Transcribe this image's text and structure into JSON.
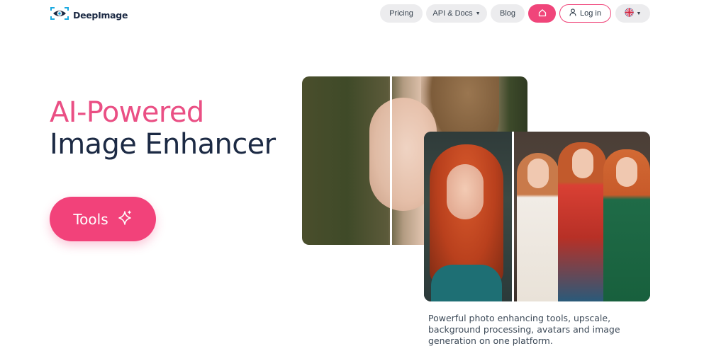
{
  "brand": {
    "name": "DeepImage"
  },
  "nav": {
    "pricing": "Pricing",
    "api_docs": "API & Docs",
    "blog": "Blog",
    "login": "Log in",
    "home_icon": "home-icon",
    "user_icon": "user-icon",
    "language_icon": "uk-flag-icon"
  },
  "hero": {
    "title_accent": "AI-Powered",
    "title_main": "Image Enhancer",
    "cta_label": "Tools",
    "cta_icon": "sparkle-icon",
    "description": "Powerful photo enhancing tools, upscale, background processing, avatars and image generation on one platform."
  },
  "colors": {
    "accent": "#f2427a",
    "title_dark": "#1c2a44",
    "pill_bg": "#ececee"
  }
}
